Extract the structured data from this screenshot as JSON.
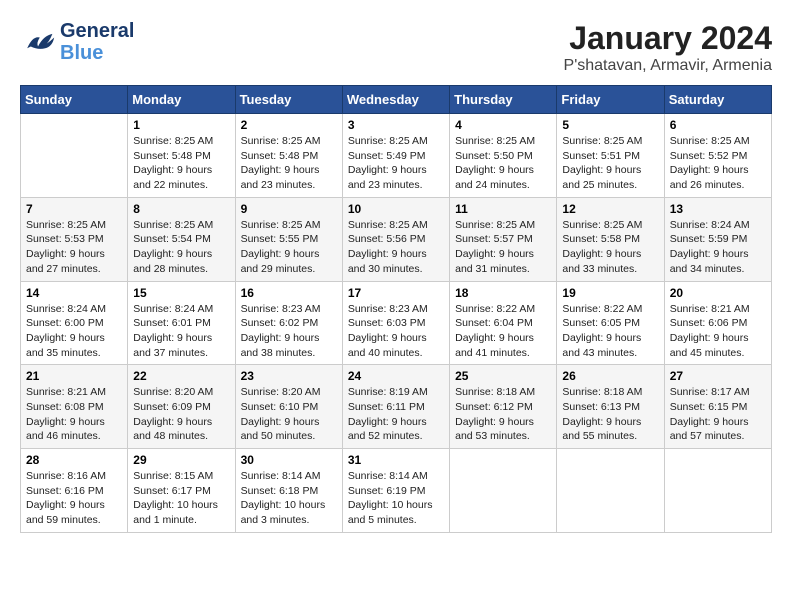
{
  "header": {
    "logo_general": "General",
    "logo_blue": "Blue",
    "title": "January 2024",
    "subtitle": "P'shatavan, Armavir, Armenia"
  },
  "calendar": {
    "weekdays": [
      "Sunday",
      "Monday",
      "Tuesday",
      "Wednesday",
      "Thursday",
      "Friday",
      "Saturday"
    ],
    "weeks": [
      [
        {
          "day": "",
          "sunrise": "",
          "sunset": "",
          "daylight": ""
        },
        {
          "day": "1",
          "sunrise": "Sunrise: 8:25 AM",
          "sunset": "Sunset: 5:48 PM",
          "daylight": "Daylight: 9 hours and 22 minutes."
        },
        {
          "day": "2",
          "sunrise": "Sunrise: 8:25 AM",
          "sunset": "Sunset: 5:48 PM",
          "daylight": "Daylight: 9 hours and 23 minutes."
        },
        {
          "day": "3",
          "sunrise": "Sunrise: 8:25 AM",
          "sunset": "Sunset: 5:49 PM",
          "daylight": "Daylight: 9 hours and 23 minutes."
        },
        {
          "day": "4",
          "sunrise": "Sunrise: 8:25 AM",
          "sunset": "Sunset: 5:50 PM",
          "daylight": "Daylight: 9 hours and 24 minutes."
        },
        {
          "day": "5",
          "sunrise": "Sunrise: 8:25 AM",
          "sunset": "Sunset: 5:51 PM",
          "daylight": "Daylight: 9 hours and 25 minutes."
        },
        {
          "day": "6",
          "sunrise": "Sunrise: 8:25 AM",
          "sunset": "Sunset: 5:52 PM",
          "daylight": "Daylight: 9 hours and 26 minutes."
        }
      ],
      [
        {
          "day": "7",
          "sunrise": "Sunrise: 8:25 AM",
          "sunset": "Sunset: 5:53 PM",
          "daylight": "Daylight: 9 hours and 27 minutes."
        },
        {
          "day": "8",
          "sunrise": "Sunrise: 8:25 AM",
          "sunset": "Sunset: 5:54 PM",
          "daylight": "Daylight: 9 hours and 28 minutes."
        },
        {
          "day": "9",
          "sunrise": "Sunrise: 8:25 AM",
          "sunset": "Sunset: 5:55 PM",
          "daylight": "Daylight: 9 hours and 29 minutes."
        },
        {
          "day": "10",
          "sunrise": "Sunrise: 8:25 AM",
          "sunset": "Sunset: 5:56 PM",
          "daylight": "Daylight: 9 hours and 30 minutes."
        },
        {
          "day": "11",
          "sunrise": "Sunrise: 8:25 AM",
          "sunset": "Sunset: 5:57 PM",
          "daylight": "Daylight: 9 hours and 31 minutes."
        },
        {
          "day": "12",
          "sunrise": "Sunrise: 8:25 AM",
          "sunset": "Sunset: 5:58 PM",
          "daylight": "Daylight: 9 hours and 33 minutes."
        },
        {
          "day": "13",
          "sunrise": "Sunrise: 8:24 AM",
          "sunset": "Sunset: 5:59 PM",
          "daylight": "Daylight: 9 hours and 34 minutes."
        }
      ],
      [
        {
          "day": "14",
          "sunrise": "Sunrise: 8:24 AM",
          "sunset": "Sunset: 6:00 PM",
          "daylight": "Daylight: 9 hours and 35 minutes."
        },
        {
          "day": "15",
          "sunrise": "Sunrise: 8:24 AM",
          "sunset": "Sunset: 6:01 PM",
          "daylight": "Daylight: 9 hours and 37 minutes."
        },
        {
          "day": "16",
          "sunrise": "Sunrise: 8:23 AM",
          "sunset": "Sunset: 6:02 PM",
          "daylight": "Daylight: 9 hours and 38 minutes."
        },
        {
          "day": "17",
          "sunrise": "Sunrise: 8:23 AM",
          "sunset": "Sunset: 6:03 PM",
          "daylight": "Daylight: 9 hours and 40 minutes."
        },
        {
          "day": "18",
          "sunrise": "Sunrise: 8:22 AM",
          "sunset": "Sunset: 6:04 PM",
          "daylight": "Daylight: 9 hours and 41 minutes."
        },
        {
          "day": "19",
          "sunrise": "Sunrise: 8:22 AM",
          "sunset": "Sunset: 6:05 PM",
          "daylight": "Daylight: 9 hours and 43 minutes."
        },
        {
          "day": "20",
          "sunrise": "Sunrise: 8:21 AM",
          "sunset": "Sunset: 6:06 PM",
          "daylight": "Daylight: 9 hours and 45 minutes."
        }
      ],
      [
        {
          "day": "21",
          "sunrise": "Sunrise: 8:21 AM",
          "sunset": "Sunset: 6:08 PM",
          "daylight": "Daylight: 9 hours and 46 minutes."
        },
        {
          "day": "22",
          "sunrise": "Sunrise: 8:20 AM",
          "sunset": "Sunset: 6:09 PM",
          "daylight": "Daylight: 9 hours and 48 minutes."
        },
        {
          "day": "23",
          "sunrise": "Sunrise: 8:20 AM",
          "sunset": "Sunset: 6:10 PM",
          "daylight": "Daylight: 9 hours and 50 minutes."
        },
        {
          "day": "24",
          "sunrise": "Sunrise: 8:19 AM",
          "sunset": "Sunset: 6:11 PM",
          "daylight": "Daylight: 9 hours and 52 minutes."
        },
        {
          "day": "25",
          "sunrise": "Sunrise: 8:18 AM",
          "sunset": "Sunset: 6:12 PM",
          "daylight": "Daylight: 9 hours and 53 minutes."
        },
        {
          "day": "26",
          "sunrise": "Sunrise: 8:18 AM",
          "sunset": "Sunset: 6:13 PM",
          "daylight": "Daylight: 9 hours and 55 minutes."
        },
        {
          "day": "27",
          "sunrise": "Sunrise: 8:17 AM",
          "sunset": "Sunset: 6:15 PM",
          "daylight": "Daylight: 9 hours and 57 minutes."
        }
      ],
      [
        {
          "day": "28",
          "sunrise": "Sunrise: 8:16 AM",
          "sunset": "Sunset: 6:16 PM",
          "daylight": "Daylight: 9 hours and 59 minutes."
        },
        {
          "day": "29",
          "sunrise": "Sunrise: 8:15 AM",
          "sunset": "Sunset: 6:17 PM",
          "daylight": "Daylight: 10 hours and 1 minute."
        },
        {
          "day": "30",
          "sunrise": "Sunrise: 8:14 AM",
          "sunset": "Sunset: 6:18 PM",
          "daylight": "Daylight: 10 hours and 3 minutes."
        },
        {
          "day": "31",
          "sunrise": "Sunrise: 8:14 AM",
          "sunset": "Sunset: 6:19 PM",
          "daylight": "Daylight: 10 hours and 5 minutes."
        },
        {
          "day": "",
          "sunrise": "",
          "sunset": "",
          "daylight": ""
        },
        {
          "day": "",
          "sunrise": "",
          "sunset": "",
          "daylight": ""
        },
        {
          "day": "",
          "sunrise": "",
          "sunset": "",
          "daylight": ""
        }
      ]
    ]
  }
}
